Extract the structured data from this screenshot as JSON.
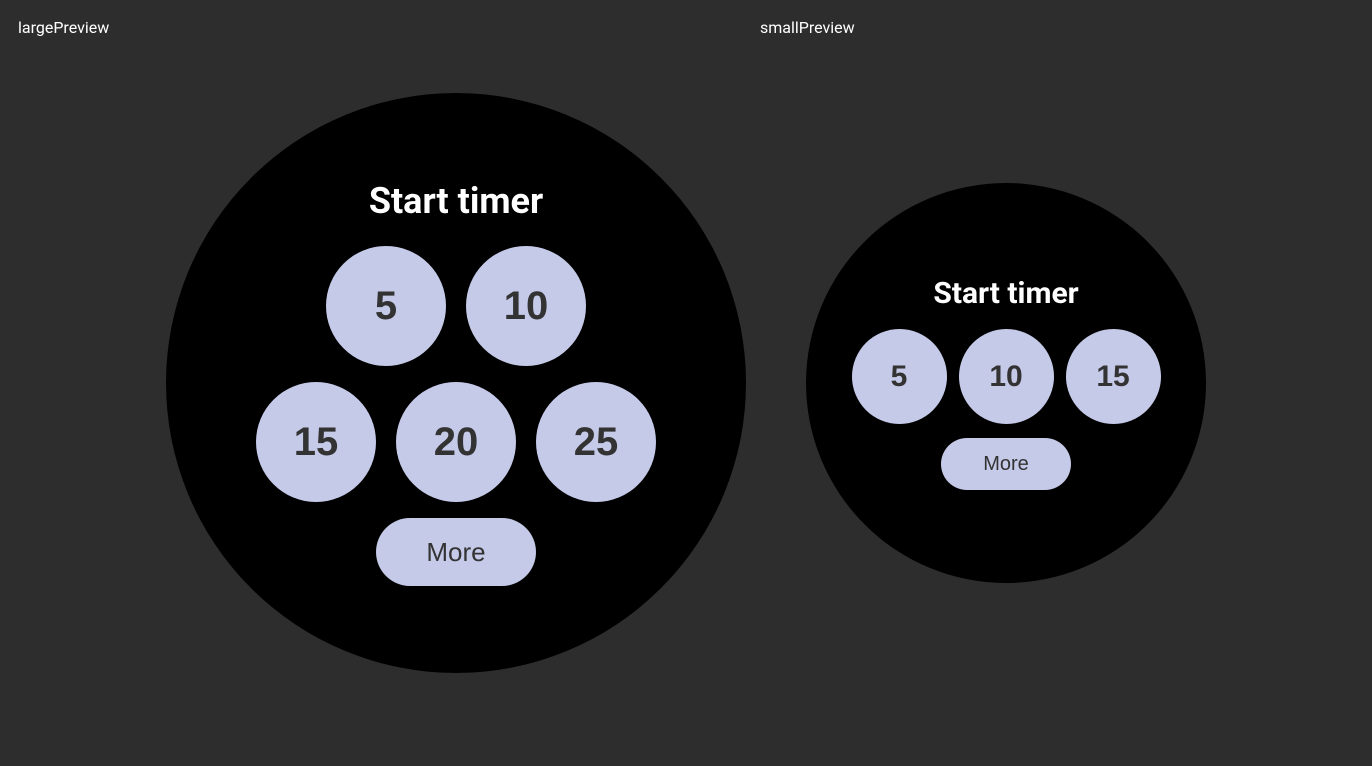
{
  "labels": {
    "large_preview": "largePreview",
    "small_preview": "smallPreview"
  },
  "large_watch": {
    "title": "Start timer",
    "buttons": [
      {
        "label": "5",
        "id": "btn-5-large"
      },
      {
        "label": "10",
        "id": "btn-10-large"
      },
      {
        "label": "15",
        "id": "btn-15-large"
      },
      {
        "label": "20",
        "id": "btn-20-large"
      },
      {
        "label": "25",
        "id": "btn-25-large"
      }
    ],
    "more_label": "More"
  },
  "small_watch": {
    "title": "Start timer",
    "buttons": [
      {
        "label": "5",
        "id": "btn-5-small"
      },
      {
        "label": "10",
        "id": "btn-10-small"
      },
      {
        "label": "15",
        "id": "btn-15-small"
      }
    ],
    "more_label": "More"
  }
}
